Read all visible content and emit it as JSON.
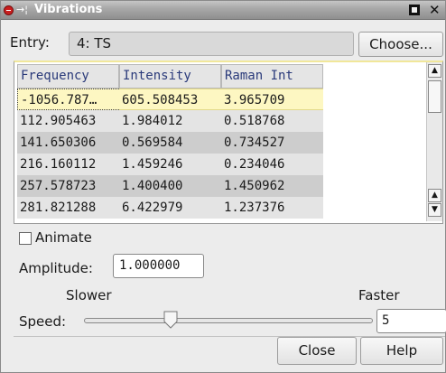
{
  "window": {
    "title": "Vibrations",
    "pin_glyph": "→¦"
  },
  "entry": {
    "label": "Entry:",
    "value": "4: TS",
    "choose_label": "Choose..."
  },
  "table": {
    "headers": [
      "Frequency",
      "Intensity",
      "Raman Int"
    ],
    "rows": [
      [
        "-1056.787…",
        "605.508453",
        "3.965709"
      ],
      [
        "112.905463",
        "1.984012",
        "0.518768"
      ],
      [
        "141.650306",
        "0.569584",
        "0.734527"
      ],
      [
        "216.160112",
        "1.459246",
        "0.234046"
      ],
      [
        "257.578723",
        "1.400400",
        "1.450962"
      ],
      [
        "281.821288",
        "6.422979",
        "1.237376"
      ]
    ],
    "selected_row": 0
  },
  "animate": {
    "label": "Animate",
    "checked": false
  },
  "amplitude": {
    "label": "Amplitude:",
    "value": "1.000000"
  },
  "speed": {
    "label": "Speed:",
    "slower_label": "Slower",
    "faster_label": "Faster",
    "value": "5",
    "slider_fraction": 0.3
  },
  "buttons": {
    "close_label": "Close",
    "help_label": "Help"
  }
}
